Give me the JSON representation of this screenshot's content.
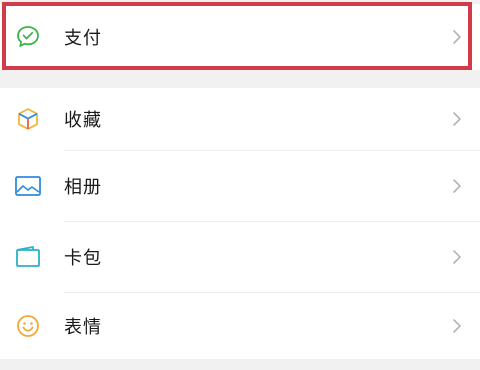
{
  "menu": {
    "items": [
      {
        "label": "支付",
        "icon": "wechat-pay-icon"
      },
      {
        "label": "收藏",
        "icon": "favorites-cube-icon"
      },
      {
        "label": "相册",
        "icon": "album-picture-icon"
      },
      {
        "label": "卡包",
        "icon": "card-wallet-icon"
      },
      {
        "label": "表情",
        "icon": "sticker-smile-icon"
      }
    ]
  },
  "colors": {
    "highlight": "#d23a4a",
    "pay_green": "#3bb54a",
    "favorites_yellow": "#f0b63a",
    "favorites_blue": "#3a8fd9",
    "album_blue": "#2f8be0",
    "card_teal": "#2cb0c6",
    "sticker_orange": "#f3a93a"
  }
}
